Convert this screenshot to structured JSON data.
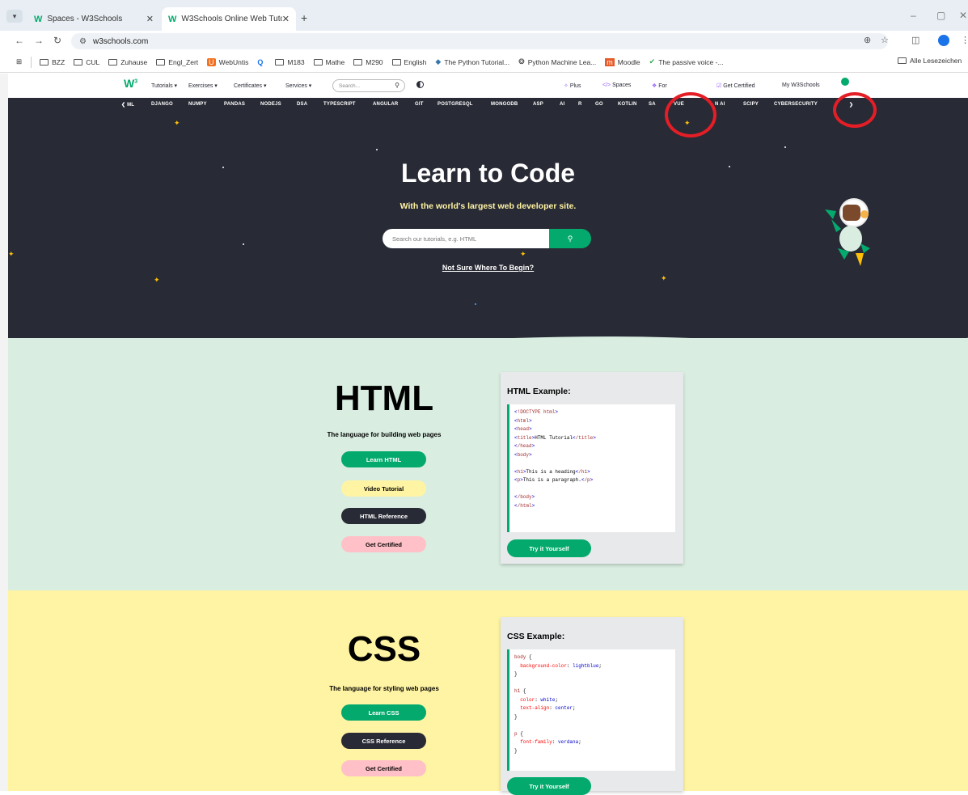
{
  "browser": {
    "tabs": [
      {
        "label": "Spaces - W3Schools",
        "icon": "w3-favicon"
      },
      {
        "label": "W3Schools Online Web Tutoria",
        "icon": "w3-favicon"
      }
    ],
    "url": "w3schools.com",
    "bookmarks": [
      {
        "label": "BZZ",
        "icon": "folder-icon"
      },
      {
        "label": "CUL",
        "icon": "folder-icon"
      },
      {
        "label": "Zuhause",
        "icon": "folder-icon"
      },
      {
        "label": "Engl_Zert",
        "icon": "folder-icon"
      },
      {
        "label": "WebUntis",
        "icon": "webuntis-icon"
      },
      {
        "label": "",
        "icon": "q-icon"
      },
      {
        "label": "M183",
        "icon": "folder-icon"
      },
      {
        "label": "Mathe",
        "icon": "folder-icon"
      },
      {
        "label": "M290",
        "icon": "folder-icon"
      },
      {
        "label": "English",
        "icon": "folder-icon"
      },
      {
        "label": "The Python Tutorial...",
        "icon": "python-icon"
      },
      {
        "label": "Python Machine Lea...",
        "icon": "w3-icon"
      },
      {
        "label": "Moodle",
        "icon": "moodle-icon"
      },
      {
        "label": "The passive voice -...",
        "icon": "check-icon"
      }
    ],
    "bookmarks_right": "Alle Lesezeichen"
  },
  "sitenav": {
    "logo": "W",
    "logo_sup": "3",
    "items": [
      "Tutorials ▾",
      "Exercises ▾",
      "Certificates ▾",
      "Services ▾"
    ],
    "search_placeholder": "Search...",
    "right_items": [
      "Plus",
      "Spaces",
      "For",
      "Get Certified",
      "My W3Schools"
    ]
  },
  "topics": [
    "❮ ML",
    "DJANGO",
    "NUMPY",
    "PANDAS",
    "NODEJS",
    "DSA",
    "TYPESCRIPT",
    "ANGULAR",
    "GIT",
    "POSTGRESQL",
    "MONGODB",
    "ASP",
    "AI",
    "R",
    "GO",
    "KOTLIN",
    "SA",
    "VUE",
    "N AI",
    "SCIPY",
    "CYBERSECURITY",
    "❯"
  ],
  "hero": {
    "title": "Learn to Code",
    "subtitle": "With the world's largest web developer site.",
    "search_placeholder": "Search our tutorials, e.g. HTML",
    "link": "Not Sure Where To Begin?"
  },
  "html_section": {
    "title": "HTML",
    "tagline": "The language for building web pages",
    "buttons": [
      "Learn HTML",
      "Video Tutorial",
      "HTML Reference",
      "Get Certified"
    ],
    "example_title": "HTML Example:",
    "try_label": "Try it Yourself"
  },
  "css_section": {
    "title": "CSS",
    "tagline": "The language for styling web pages",
    "buttons": [
      "Learn CSS",
      "CSS Reference",
      "Get Certified"
    ],
    "example_title": "CSS Example:",
    "try_label": "Try it Yourself"
  },
  "colors": {
    "brand_green": "#04aa6d",
    "dark": "#282a35",
    "html_bg": "#d9eee1",
    "css_bg": "#fff4a3",
    "annotation_red": "#e41e26"
  }
}
